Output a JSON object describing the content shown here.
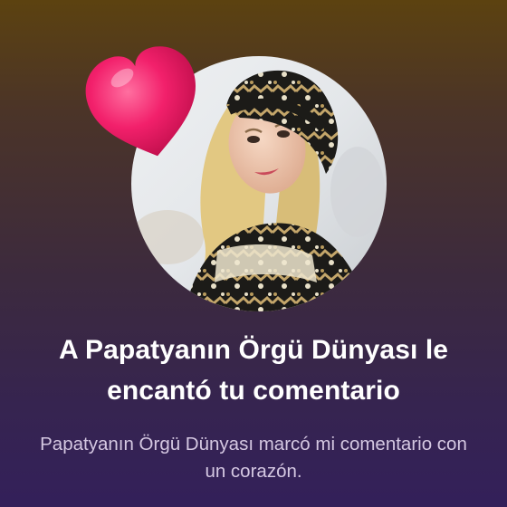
{
  "notification": {
    "title": "A Papatyanın Örgü Dünyası le encantó tu comentario",
    "subtitle": "Papatyanın Örgü Dünyası marcó mi comentario con un corazón."
  },
  "icons": {
    "reaction": "heart-icon"
  },
  "colors": {
    "background_top": "#5c4210",
    "background_bottom": "#33205a",
    "heart": "#ee1d68",
    "title_text": "#ffffff",
    "subtitle_text": "#d5c8e2"
  }
}
